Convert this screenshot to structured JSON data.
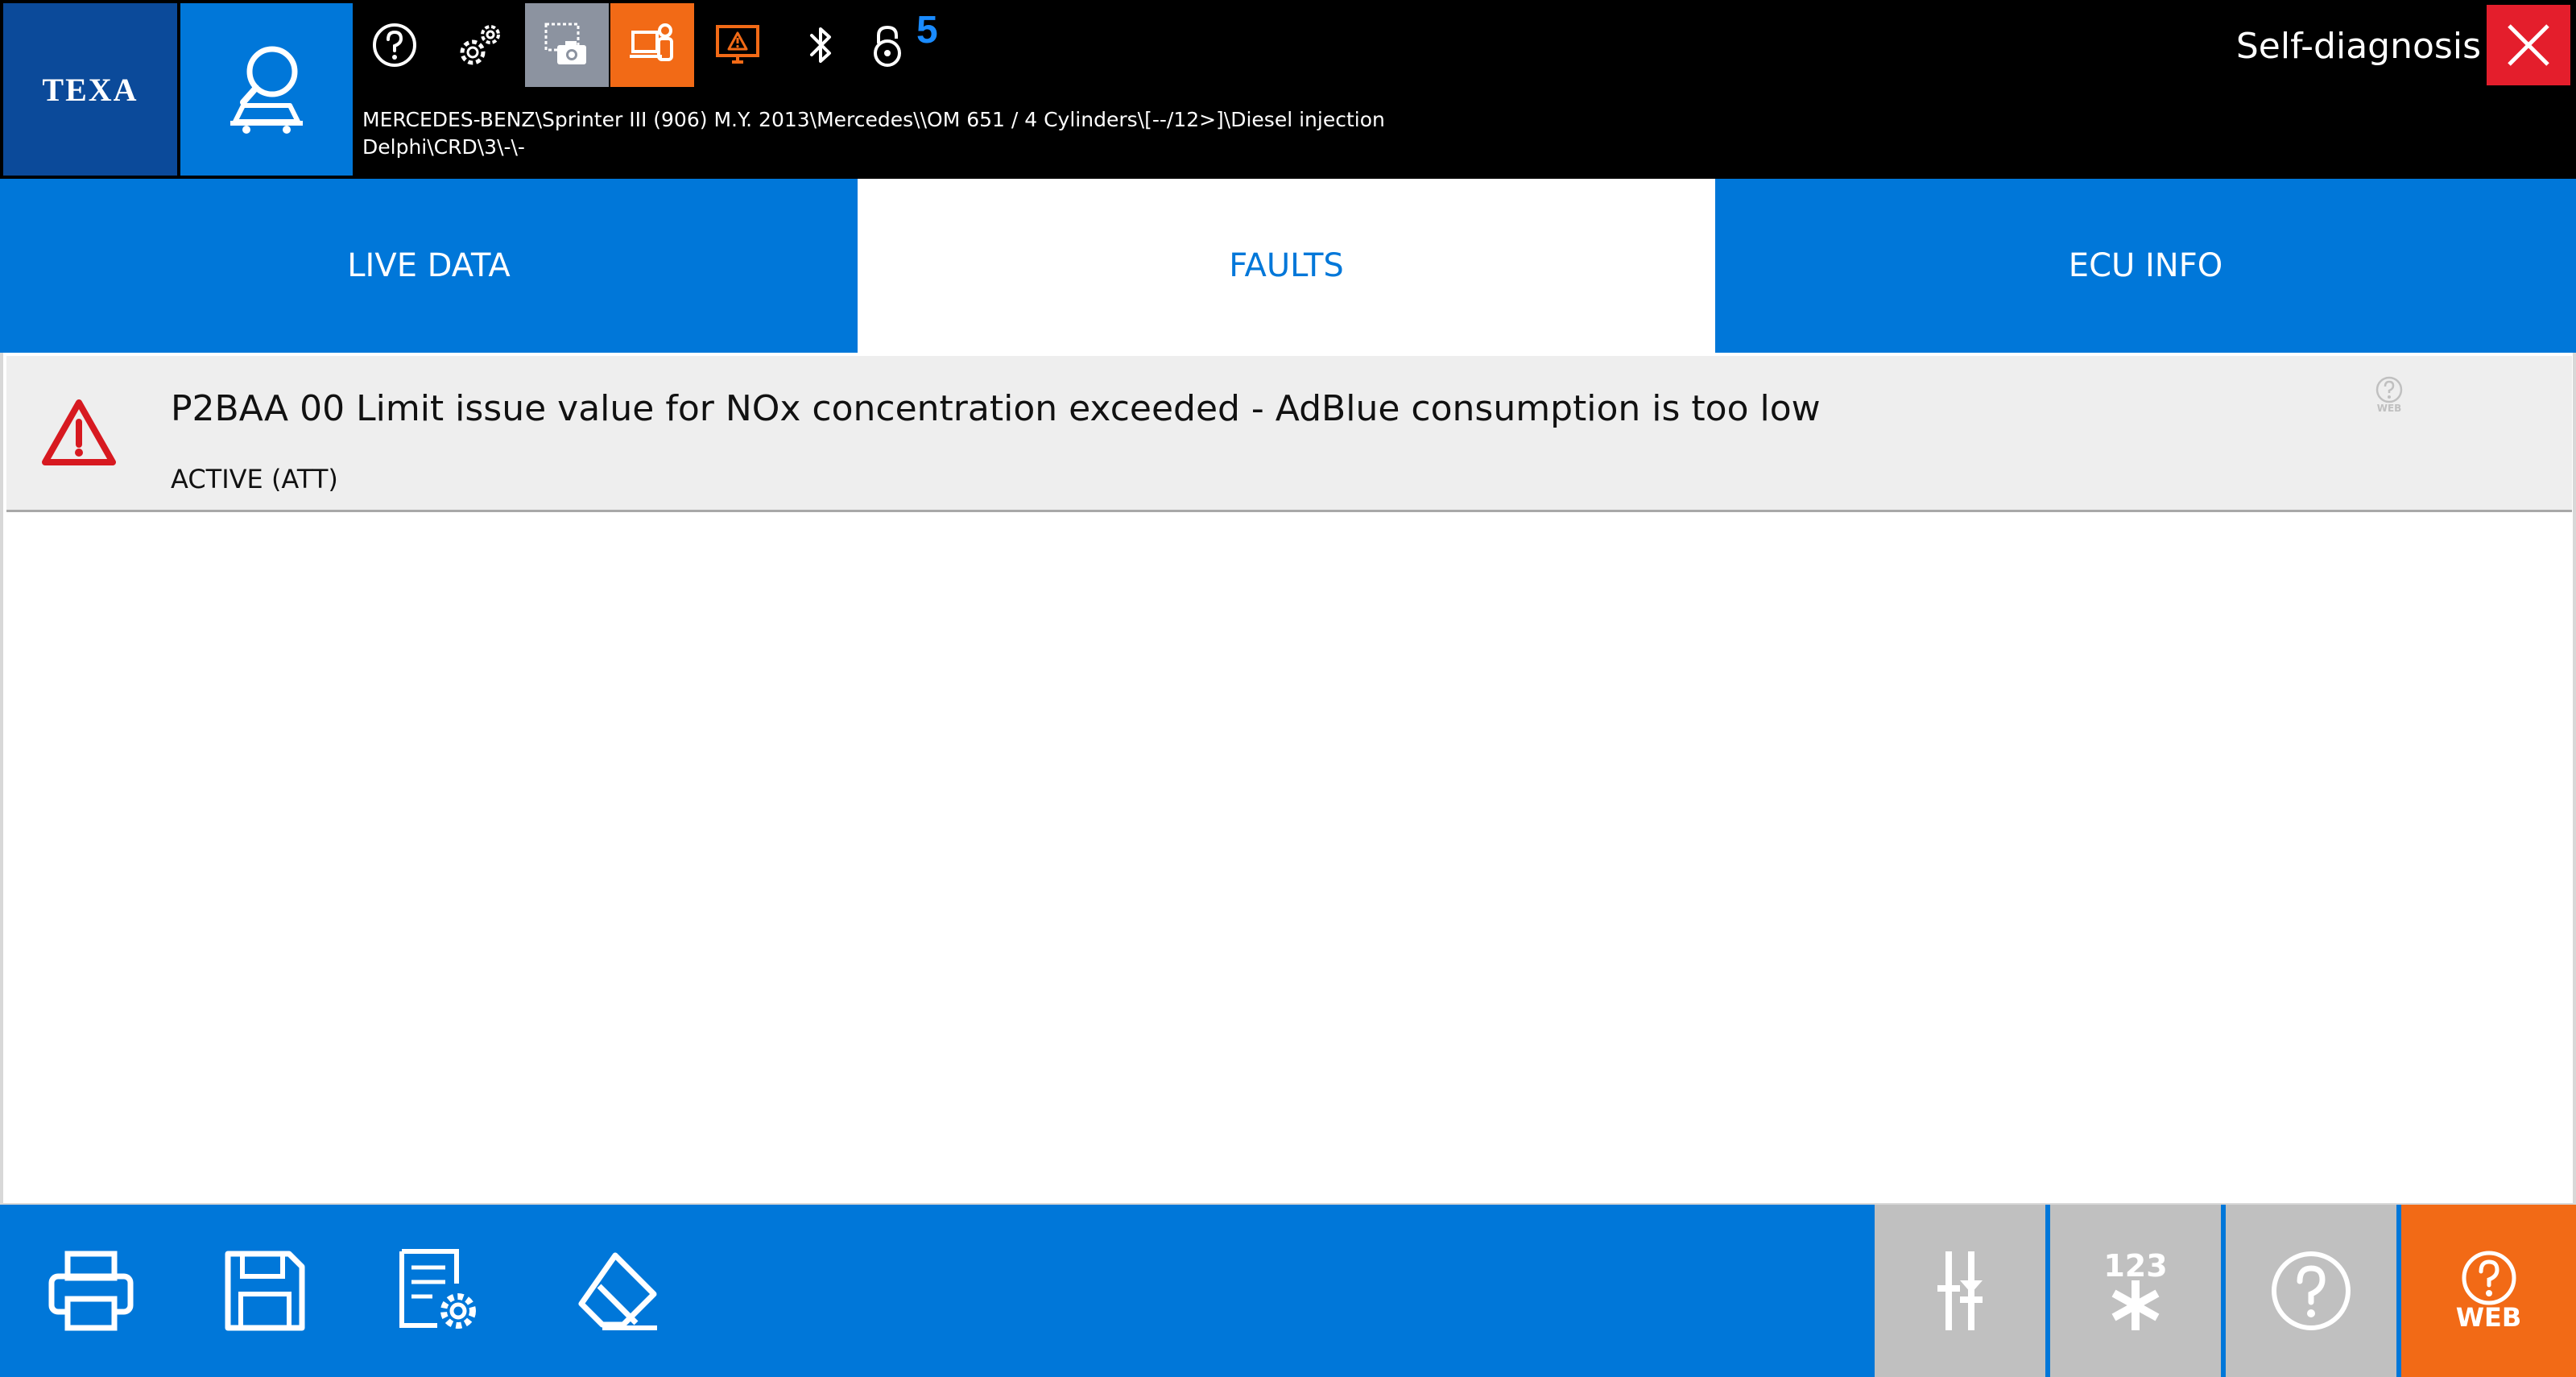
{
  "header": {
    "logo_text": "TEXA",
    "vehicle_path_line1": "MERCEDES-BENZ\\Sprinter III (906) M.Y. 2013\\Mercedes\\\\OM 651 / 4 Cylinders\\[--/12>]\\Diesel injection",
    "vehicle_path_line2": "Delphi\\CRD\\3\\-\\-",
    "window_title": "Self-diagnosis",
    "lock_count": "5",
    "icons": [
      "app-search-icon",
      "help-icon",
      "gear-icon",
      "screenshot-icon",
      "remote-assist-icon",
      "warning-monitor-icon",
      "bluetooth-icon",
      "lock-icon",
      "close-icon"
    ]
  },
  "tabs": [
    {
      "label": "LIVE DATA",
      "active": false
    },
    {
      "label": "FAULTS",
      "active": true
    },
    {
      "label": "ECU INFO",
      "active": false
    }
  ],
  "faults": [
    {
      "title": "P2BAA 00 Limit issue value for NOx concentration exceeded - AdBlue consumption is too low",
      "status": "ACTIVE (ATT)",
      "web_label": "WEB"
    }
  ],
  "bottom_toolbar": {
    "left_icons": [
      "print-icon",
      "save-icon",
      "report-settings-icon",
      "erase-icon"
    ],
    "codes_label": "123",
    "web_help_label": "WEB"
  },
  "colors": {
    "accent_blue": "#0077d9",
    "logo_blue": "#0b4a9a",
    "orange": "#f26a16",
    "close_red": "#e41e2c",
    "warning_red": "#d71920",
    "grey_button": "#c0c0c0"
  }
}
